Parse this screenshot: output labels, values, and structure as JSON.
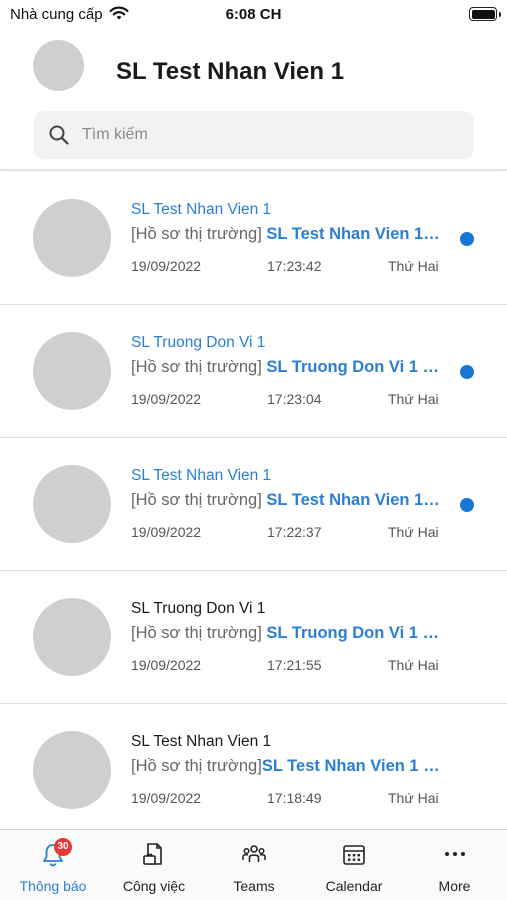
{
  "status_bar": {
    "carrier": "Nhà cung cấp",
    "time": "6:08 CH"
  },
  "header": {
    "title": "SL Test Nhan Vien 1"
  },
  "search": {
    "placeholder": "Tìm kiếm"
  },
  "notifications": [
    {
      "sender": "SL Test Nhan Vien 1",
      "prefix": "[Hồ sơ thị trường] ",
      "message_bold": "SL Test Nhan Vien 1 đã ...",
      "date": "19/09/2022",
      "time": "17:23:42",
      "day": "Thứ Hai",
      "unread": true
    },
    {
      "sender": "SL Truong Don Vi 1",
      "prefix": "[Hồ sơ thị trường] ",
      "message_bold": "SL Truong Don Vi 1 đã ...",
      "date": "19/09/2022",
      "time": "17:23:04",
      "day": "Thứ Hai",
      "unread": true
    },
    {
      "sender": "SL Test Nhan Vien 1",
      "prefix": "[Hồ sơ thị trường] ",
      "message_bold": "SL Test Nhan Vien 1 đã ...",
      "date": "19/09/2022",
      "time": "17:22:37",
      "day": "Thứ Hai",
      "unread": true
    },
    {
      "sender": "SL Truong Don Vi 1",
      "prefix": "[Hồ sơ thị trường] ",
      "message_bold": "SL Truong Don Vi 1 đã ...",
      "date": "19/09/2022",
      "time": "17:21:55",
      "day": "Thứ Hai",
      "unread": false
    },
    {
      "sender": "SL Test Nhan Vien 1",
      "prefix": "[Hồ sơ thị trường]",
      "message_bold": "SL Test Nhan Vien 1 đã ...",
      "date": "19/09/2022",
      "time": "17:18:49",
      "day": "Thứ Hai",
      "unread": false
    }
  ],
  "tab_bar": {
    "tabs": [
      {
        "label": "Thông báo",
        "icon": "bell-icon",
        "badge": "30",
        "active": true
      },
      {
        "label": "Công việc",
        "icon": "task-document-icon",
        "active": false
      },
      {
        "label": "Teams",
        "icon": "teams-people-icon",
        "active": false
      },
      {
        "label": "Calendar",
        "icon": "calendar-icon",
        "active": false
      },
      {
        "label": "More",
        "icon": "more-dots-icon",
        "active": false
      }
    ]
  },
  "colors": {
    "accent": "#2b7fd0",
    "unread_dot": "#1976d2",
    "badge": "#e53935",
    "avatar_placeholder": "#cfcfcf"
  }
}
